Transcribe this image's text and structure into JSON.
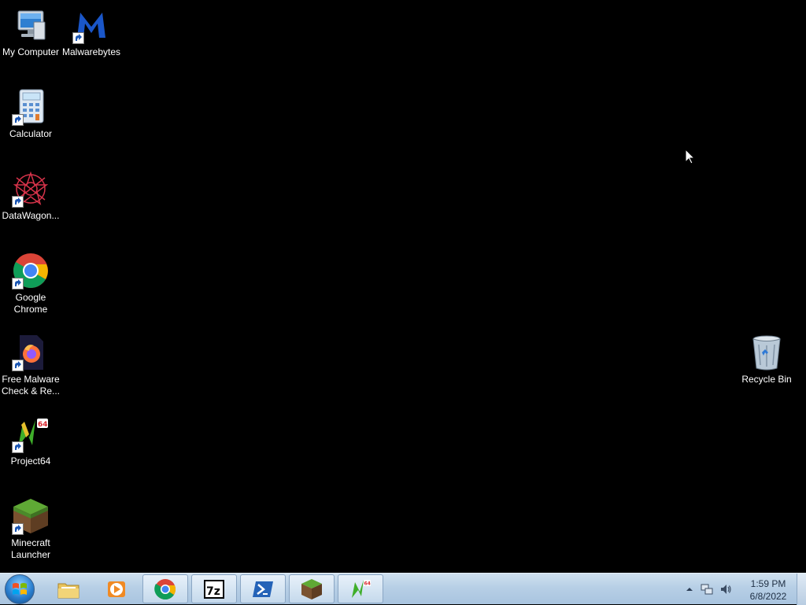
{
  "desktop": {
    "icons": [
      {
        "label": "My Computer",
        "icon": "computer-icon"
      },
      {
        "label": "Malwarebytes",
        "icon": "malwarebytes-icon"
      },
      {
        "label": "Calculator",
        "icon": "calculator-icon"
      },
      {
        "label": "DataWagon...",
        "icon": "datawagon-icon"
      },
      {
        "label": "Google\nChrome",
        "icon": "chrome-icon"
      },
      {
        "label": "Free Malware\nCheck & Re...",
        "icon": "firefox-file-icon"
      },
      {
        "label": "Project64",
        "icon": "project64-icon"
      },
      {
        "label": "Minecraft\nLauncher",
        "icon": "minecraft-icon"
      },
      {
        "label": "Recycle Bin",
        "icon": "recycle-bin-icon"
      }
    ]
  },
  "taskbar": {
    "pinned": [
      {
        "name": "File Explorer",
        "icon": "folder-icon"
      },
      {
        "name": "Windows Media Player",
        "icon": "media-player-icon"
      },
      {
        "name": "Google Chrome",
        "icon": "chrome-icon"
      },
      {
        "name": "7-Zip",
        "icon": "7zip-icon"
      },
      {
        "name": "PowerShell",
        "icon": "powershell-icon"
      },
      {
        "name": "Minecraft Launcher",
        "icon": "minecraft-icon"
      },
      {
        "name": "Project64",
        "icon": "project64-icon"
      }
    ],
    "tray": {
      "time": "1:59 PM",
      "date": "6/8/2022"
    }
  },
  "colors": {
    "desktop_background": "#000000",
    "taskbar": "#b7cfe6"
  }
}
